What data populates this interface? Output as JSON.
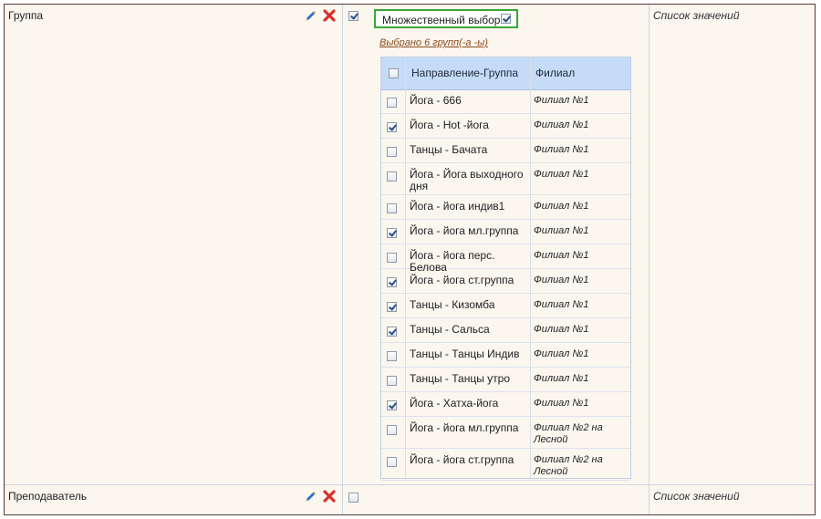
{
  "fields": [
    {
      "name": "Группа",
      "checked": true,
      "type_label": "Список значений"
    },
    {
      "name": "Преподаватель",
      "checked": false,
      "type_label": "Список значений"
    }
  ],
  "multi_select": {
    "label": "Множественный выбор",
    "checked": true
  },
  "selected_summary": "Выбрано 6 групп(-а -ы)",
  "table": {
    "header_checked": false,
    "columns": [
      "Направление-Группа",
      "Филиал"
    ],
    "rows": [
      {
        "group": "Йога - 666",
        "branch": "Филиал №1",
        "checked": false
      },
      {
        "group": "Йога - Hot -йога",
        "branch": "Филиал №1",
        "checked": true
      },
      {
        "group": "Танцы - Бачата",
        "branch": "Филиал №1",
        "checked": false
      },
      {
        "group": "Йога - Йога выходного дня",
        "branch": "Филиал №1",
        "checked": false
      },
      {
        "group": "Йога - йога индив1",
        "branch": "Филиал №1",
        "checked": false
      },
      {
        "group": "Йога - йога мл.группа",
        "branch": "Филиал №1",
        "checked": true
      },
      {
        "group": "Йога - йога перс. Белова",
        "branch": "Филиал №1",
        "checked": false
      },
      {
        "group": "Йога - йога ст.группа",
        "branch": "Филиал №1",
        "checked": true
      },
      {
        "group": "Танцы - Кизомба",
        "branch": "Филиал №1",
        "checked": true
      },
      {
        "group": "Танцы - Сальса",
        "branch": "Филиал №1",
        "checked": true
      },
      {
        "group": "Танцы - Танцы Индив",
        "branch": "Филиал №1",
        "checked": false
      },
      {
        "group": "Танцы - Танцы утро",
        "branch": "Филиал №1",
        "checked": false
      },
      {
        "group": "Йога - Хатха-йога",
        "branch": "Филиал №1",
        "checked": true
      },
      {
        "group": "Йога - йога мл.группа",
        "branch": "Филиал №2 на Лесной",
        "checked": false
      },
      {
        "group": "Йога - йога ст.группа",
        "branch": "Филиал №2 на Лесной",
        "checked": false
      }
    ]
  },
  "icons": {
    "edit": "pencil-icon",
    "delete": "close-icon"
  },
  "colors": {
    "frame_border": "#5a3a3a",
    "background": "#fbf6ee",
    "header": "#c6dbf7",
    "highlight_border": "#3aa63a",
    "link": "#8b4a1a",
    "delete_icon": "#d9302b"
  }
}
